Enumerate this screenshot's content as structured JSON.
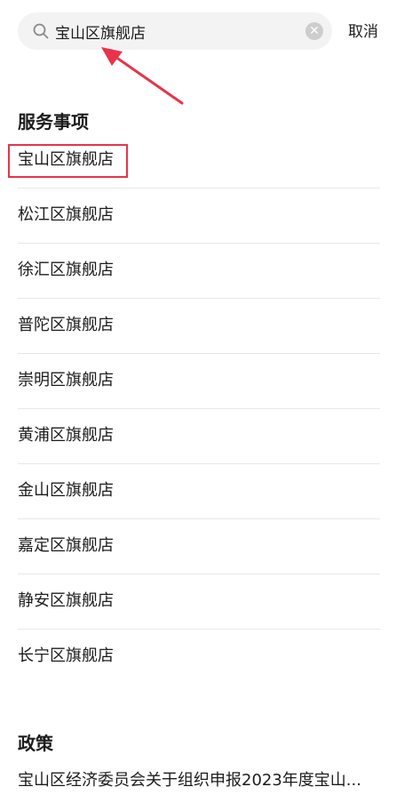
{
  "search": {
    "value": "宝山区旗舰店",
    "cancel_label": "取消"
  },
  "services": {
    "title": "服务事项",
    "items": [
      {
        "label": "宝山区旗舰店"
      },
      {
        "label": "松江区旗舰店"
      },
      {
        "label": "徐汇区旗舰店"
      },
      {
        "label": "普陀区旗舰店"
      },
      {
        "label": "崇明区旗舰店"
      },
      {
        "label": "黄浦区旗舰店"
      },
      {
        "label": "金山区旗舰店"
      },
      {
        "label": "嘉定区旗舰店"
      },
      {
        "label": "静安区旗舰店"
      },
      {
        "label": "长宁区旗舰店"
      }
    ]
  },
  "policy": {
    "title": "政策",
    "items": [
      {
        "label": "宝山区经济委员会关于组织申报2023年度宝山..."
      }
    ]
  },
  "icons": {
    "search": "search-icon",
    "clear": "close-circle-icon"
  },
  "colors": {
    "annotation": "#e8334b",
    "search_bg": "#f3f3f3"
  }
}
